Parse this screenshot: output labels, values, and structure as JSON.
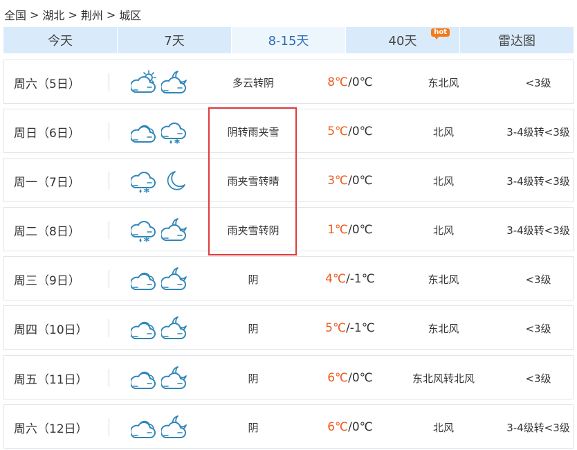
{
  "breadcrumb": {
    "items": [
      "全国",
      "湖北",
      "荆州",
      "城区"
    ],
    "separator": ">"
  },
  "tabs": [
    {
      "label": "今天",
      "active": false
    },
    {
      "label": "7天",
      "active": false
    },
    {
      "label": "8-15天",
      "active": true
    },
    {
      "label": "40天",
      "active": false,
      "badge": "hot"
    },
    {
      "label": "雷达图",
      "active": false
    }
  ],
  "forecast": [
    {
      "day": "周六（5日）",
      "icon_day": "cloudy-sun-icon",
      "icon_night": "cloud-moon-icon",
      "desc": "多云转阴",
      "high": "8℃",
      "low": "/0℃",
      "wind": "东北风",
      "level": "<3级"
    },
    {
      "day": "周日（6日）",
      "icon_day": "overcast-icon",
      "icon_night": "sleet-icon",
      "desc": "阴转雨夹雪",
      "high": "5℃",
      "low": "/0℃",
      "wind": "北风",
      "level": "3-4级转<3级"
    },
    {
      "day": "周一（7日）",
      "icon_day": "sleet-icon",
      "icon_night": "moon-icon",
      "desc": "雨夹雪转晴",
      "high": "3℃",
      "low": "/0℃",
      "wind": "北风",
      "level": "3-4级转<3级"
    },
    {
      "day": "周二（8日）",
      "icon_day": "sleet-icon",
      "icon_night": "cloud-moon-icon",
      "desc": "雨夹雪转阴",
      "high": "1℃",
      "low": "/0℃",
      "wind": "北风",
      "level": "3-4级转<3级"
    },
    {
      "day": "周三（9日）",
      "icon_day": "overcast-icon",
      "icon_night": "cloud-moon-icon",
      "desc": "阴",
      "high": "4℃",
      "low": "/-1℃",
      "wind": "东北风",
      "level": "<3级"
    },
    {
      "day": "周四（10日）",
      "icon_day": "overcast-icon",
      "icon_night": "cloud-moon-icon",
      "desc": "阴",
      "high": "5℃",
      "low": "/-1℃",
      "wind": "东北风",
      "level": "<3级"
    },
    {
      "day": "周五（11日）",
      "icon_day": "overcast-icon",
      "icon_night": "cloud-moon-icon",
      "desc": "阴",
      "high": "6℃",
      "low": "/0℃",
      "wind": "东北风转北风",
      "level": "<3级"
    },
    {
      "day": "周六（12日）",
      "icon_day": "overcast-icon",
      "icon_night": "cloud-moon-icon",
      "desc": "阴",
      "high": "6℃",
      "low": "/0℃",
      "wind": "北风",
      "level": "3-4级转<3级"
    }
  ],
  "colors": {
    "accent": "#2a6eb5",
    "tab_bg": "#d9ebfb",
    "tab_active_bg": "#eef6fd",
    "high_temp": "#f05a1a",
    "icon_stroke": "#2f86b8",
    "hot_badge": "#f57a1a",
    "highlight_box": "#e03b3b"
  }
}
